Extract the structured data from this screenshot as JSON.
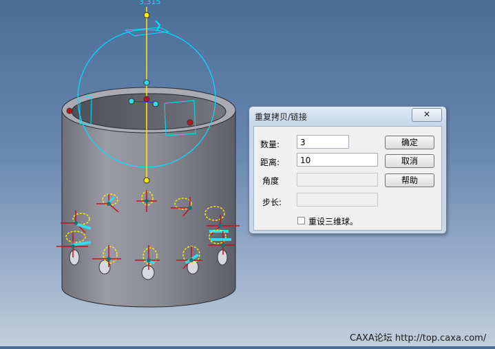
{
  "dimension_value": "3.315",
  "dialog": {
    "title": "重复拷贝/链接",
    "close_label": "✕",
    "fields": {
      "count_label": "数量:",
      "count_value": "3",
      "distance_label": "距离:",
      "distance_value": "10",
      "angle_label": "角度",
      "angle_value": "",
      "step_label": "步长:",
      "step_value": ""
    },
    "buttons": {
      "ok": "确定",
      "cancel": "取消",
      "help": "帮助"
    },
    "reset_checkbox": {
      "label": "重设三维球。",
      "checked": false
    }
  },
  "watermark": "CAXA论坛 http://top.caxa.com/",
  "colors": {
    "sphere": "#00e0ff",
    "axis": "#ffee00",
    "handle_red": "#c0121e",
    "handle_cyan": "#33ddee",
    "cylinder": "#8e8f98"
  }
}
